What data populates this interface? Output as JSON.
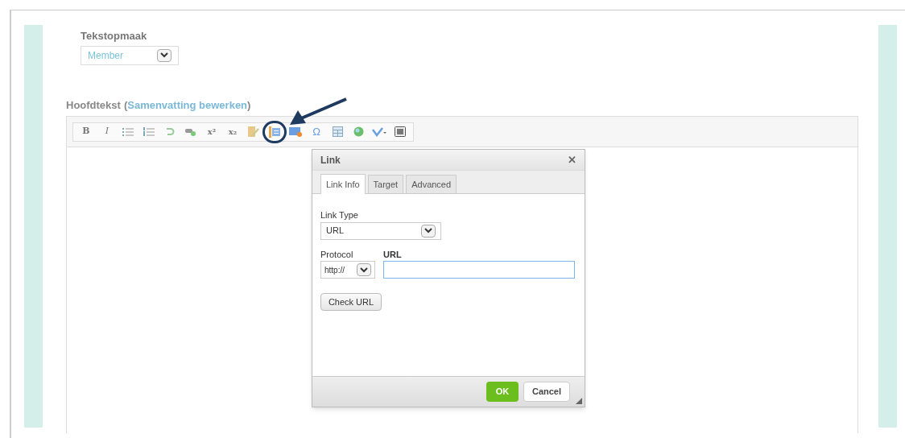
{
  "format_field": {
    "label": "Tekstopmaak",
    "value": "Member"
  },
  "editor": {
    "label": "Hoofdtekst",
    "label_open": "(",
    "link": "Samenvatting bewerken",
    "label_close": ")",
    "toolbar": [
      {
        "kind": "glyph",
        "label": "B",
        "circled": false
      },
      {
        "kind": "glyph",
        "label": "I",
        "circled": false
      },
      {
        "kind": "icon",
        "circled": false
      },
      {
        "kind": "icon",
        "circled": false
      },
      {
        "kind": "icon",
        "circled": false
      },
      {
        "kind": "icon",
        "circled": false
      },
      {
        "kind": "glyph",
        "label": "x²",
        "circled": false
      },
      {
        "kind": "glyph",
        "label": "x₂",
        "circled": false
      },
      {
        "kind": "icon",
        "circled": false
      },
      {
        "kind": "icon",
        "circled": true
      },
      {
        "kind": "icon",
        "circled": false
      },
      {
        "kind": "glyph",
        "label": "Ω",
        "circled": false
      },
      {
        "kind": "icon",
        "circled": false
      },
      {
        "kind": "icon",
        "circled": false
      },
      {
        "kind": "icon",
        "circled": false
      },
      {
        "kind": "icon",
        "circled": false
      }
    ]
  },
  "dialog": {
    "title": "Link",
    "close": "✕",
    "tabs": [
      {
        "label": "Link Info",
        "selected": true
      },
      {
        "label": "Target",
        "selected": false
      },
      {
        "label": "Advanced",
        "selected": false
      }
    ],
    "link_type": {
      "label": "Link Type",
      "value": "URL"
    },
    "protocol": {
      "label": "Protocol",
      "value": "http://"
    },
    "url": {
      "label": "URL"
    },
    "check_button": "Check URL",
    "buttons": [
      {
        "label": "OK",
        "kind": "primary"
      },
      {
        "label": "Cancel",
        "kind": "secondary"
      }
    ]
  }
}
